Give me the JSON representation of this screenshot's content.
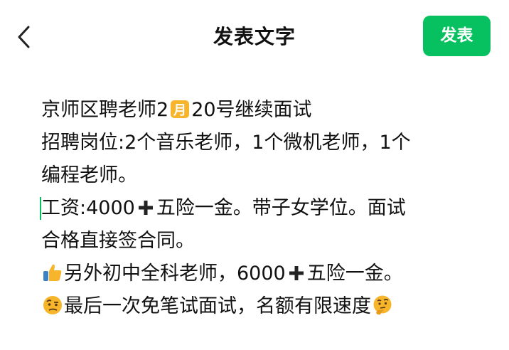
{
  "header": {
    "title": "发表文字",
    "publish_label": "发表"
  },
  "post": {
    "line1_a": "京师区聘老师2",
    "line1_b": "20号继续面试",
    "line2": "招聘岗位:2个音乐老师，1个微机老师，1个",
    "line3": "编程老师。",
    "line4_a": "工资:4000",
    "line4_b": "五险一金。带子女学位。面试",
    "line5": "合格直接签合同。",
    "line6_a": "另外初中全科老师，6000",
    "line6_b": "五险一金。",
    "line7": "最后一次免笔试面试，名额有限速度"
  },
  "icons": {
    "back": "chevron-left-icon",
    "month": "calendar-month-emoji",
    "plus": "heavy-plus-icon",
    "thumbs": "thumbs-up-emoji",
    "skeptical": "raised-eyebrow-emoji",
    "thinking": "thinking-face-emoji"
  },
  "colors": {
    "accent": "#07c160",
    "text": "#111111",
    "emoji_yellow": "#f7b52c"
  }
}
